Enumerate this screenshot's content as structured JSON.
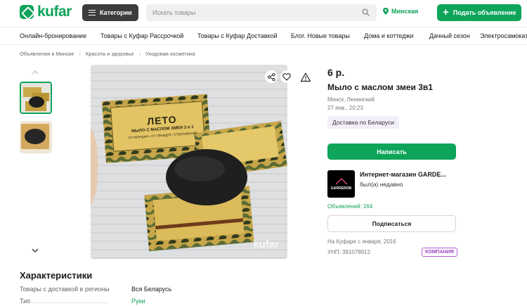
{
  "header": {
    "logo_text": "kufar",
    "categories_label": "Категории",
    "search_placeholder": "Искать товары",
    "location": "Минская",
    "post_button": "Подать объявление"
  },
  "nav": {
    "items": [
      "Онлайн-бронирование",
      "Товары с Куфар Рассрочкой",
      "Товары с Куфар Доставкой",
      "Блог. Новые товары",
      "Дома и коттеджи",
      "Дачный сезон",
      "Электросамокаты"
    ]
  },
  "breadcrumbs": [
    "Объявления в Минске",
    "Красота и здоровье",
    "Уходовая косметика"
  ],
  "gallery": {
    "watermark": "kufar",
    "box_text": {
      "brand": "ЛЕТО",
      "product": "МЫЛО С МАСЛОМ ЗМЕИ 3 в 1",
      "benefits": "ОТ МОРЩИН • ОТ ПРЫЩЕЙ • ОТБЕЛИВАНИЕ"
    }
  },
  "listing": {
    "price": "6 р.",
    "title": "Мыло с маслом змеи 3в1",
    "location": "Минск, Ленинский",
    "date": "27 янв., 20:23",
    "delivery_badge": "Доставка по Беларуси",
    "write_button": "Написать"
  },
  "seller": {
    "logo_text": "GARDEROB",
    "name": "Интернет-магазин GARDE...",
    "status": "был(а) недавно",
    "ads_count": "Объявлений: 164",
    "subscribe_button": "Подписаться",
    "since": "На Куфаре с января, 2016",
    "unp": "УНП: 391078912",
    "company_badge": "КОМПАНИЯ"
  },
  "characteristics": {
    "title": "Характеристики",
    "rows": [
      {
        "key": "Товары с доставкой в регионы",
        "value": "Вся Беларусь"
      },
      {
        "key": "Тип",
        "value": "Руки"
      }
    ]
  },
  "colors": {
    "brand_green": "#0ea45a",
    "company_purple": "#9b3fc6"
  }
}
